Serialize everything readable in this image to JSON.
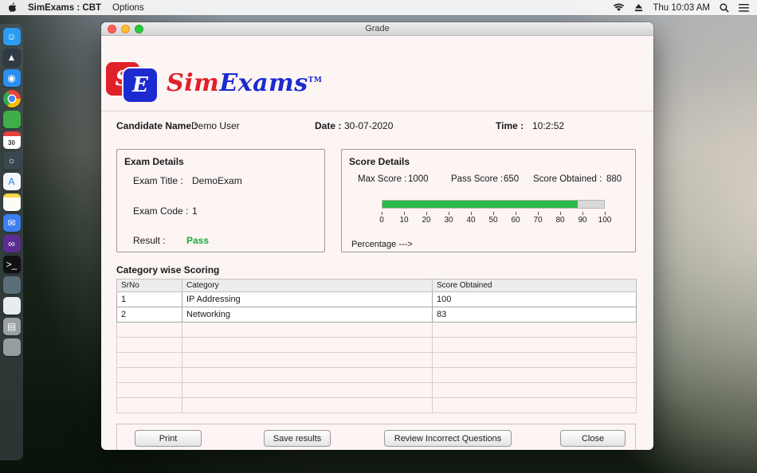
{
  "colors": {
    "logo_red": "#e02128",
    "logo_blue": "#1c2bd0",
    "bar_green": "#2db84b",
    "pass_green": "#1fa83d"
  },
  "menubar": {
    "app_name": "SimExams : CBT",
    "menu_options": "Options",
    "clock": "Thu 10:03 AM",
    "icons": [
      "apple-icon",
      "wifi-icon",
      "eject-icon",
      "search-icon",
      "menu-list-icon"
    ]
  },
  "dock": {
    "items": [
      {
        "name": "finder",
        "glyph": "☺",
        "bg": "#2b9cf2"
      },
      {
        "name": "launchpad",
        "glyph": "▲",
        "bg": "#2f3a46"
      },
      {
        "name": "safari",
        "glyph": "◉",
        "bg": "#2a8ff0"
      },
      {
        "name": "chrome",
        "glyph": "",
        "bg": "chrome"
      },
      {
        "name": "green-app",
        "glyph": "",
        "bg": "#3fae49"
      },
      {
        "name": "calendar",
        "glyph": "30",
        "bg": "calendar"
      },
      {
        "name": "clock-app",
        "glyph": "○",
        "bg": "#3a4750"
      },
      {
        "name": "app-store",
        "glyph": "A",
        "bg": "#f4f6f8",
        "fg": "#1d7ff0"
      },
      {
        "name": "notes",
        "glyph": "",
        "bg": "notes"
      },
      {
        "name": "mail",
        "glyph": "✉",
        "bg": "#3d7ff0"
      },
      {
        "name": "vscode",
        "glyph": "∞",
        "bg": "#5c2d91"
      },
      {
        "name": "terminal",
        "glyph": ">_",
        "bg": "#111111"
      },
      {
        "name": "utility",
        "glyph": "",
        "bg": "#5a6e7a"
      },
      {
        "name": "cup",
        "glyph": "",
        "bg": "#e8ecef"
      },
      {
        "name": "database",
        "glyph": "▤",
        "bg": "#9aa0a6"
      },
      {
        "name": "trash",
        "glyph": "",
        "bg": "rgba(235,240,244,0.55)"
      }
    ]
  },
  "window": {
    "title": "Grade",
    "logo": {
      "s": "S",
      "e": "E",
      "sim": "Sim",
      "exams": "Exams",
      "tm": "TM"
    },
    "candidate": {
      "name_label": "Candidate Name :",
      "name": "Demo User",
      "date_label": "Date :",
      "date": "30-07-2020",
      "time_label": "Time :",
      "time": "10:2:52"
    },
    "exam_details": {
      "title": "Exam Details",
      "exam_title_label": "Exam Title :",
      "exam_title": "DemoExam",
      "exam_code_label": "Exam Code :",
      "exam_code": "1",
      "result_label": "Result :",
      "result": "Pass"
    },
    "score_details": {
      "title": "Score Details",
      "max_score_label": "Max Score :",
      "max_score": "1000",
      "pass_score_label": "Pass Score :",
      "pass_score": "650",
      "score_obtained_label": "Score Obtained :",
      "score_obtained": "880",
      "percent": 88,
      "scale": [
        "0",
        "10",
        "20",
        "30",
        "40",
        "50",
        "60",
        "70",
        "80",
        "90",
        "100"
      ],
      "percentage_label": "Percentage --->"
    },
    "category_table": {
      "title": "Category wise Scoring",
      "headers": [
        "SrNo",
        "Category",
        "Score Obtained"
      ],
      "rows": [
        [
          "1",
          "IP Addressing",
          "100"
        ],
        [
          "2",
          "Networking",
          "83"
        ]
      ],
      "empty_rows": 6
    },
    "buttons": [
      "Print",
      "Save results",
      "Review Incorrect Questions",
      "Close"
    ]
  }
}
